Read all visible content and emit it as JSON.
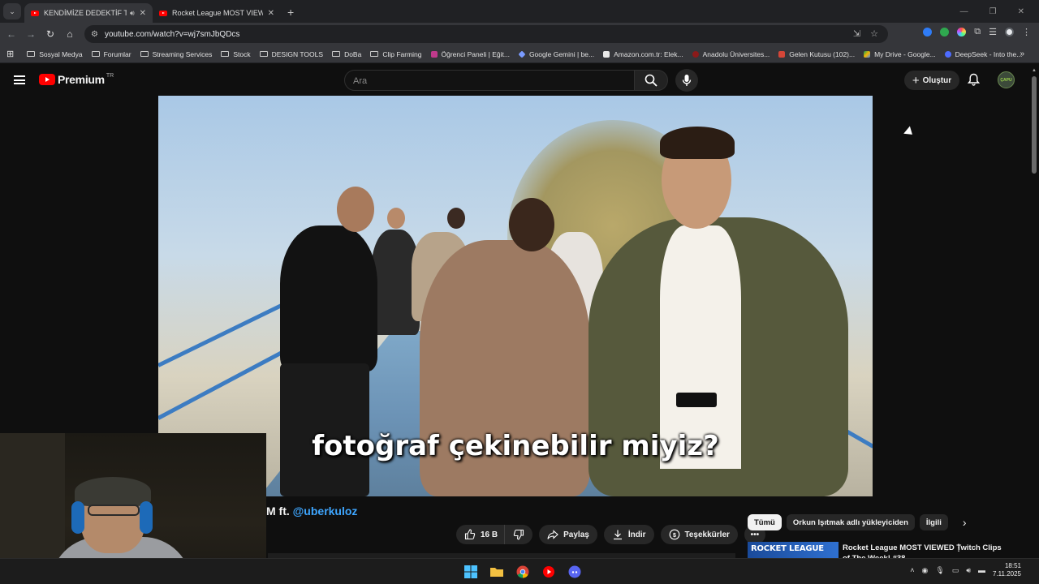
{
  "browser": {
    "tabs": [
      {
        "title": "KENDİMİZE DEDEKTİF TUTT",
        "active": true
      },
      {
        "title": "Rocket League MOST VIEWED",
        "active": false
      }
    ],
    "url": "youtube.com/watch?v=wj7smJbQDcs",
    "bookmarks": [
      {
        "label": "Sosyal Medya",
        "type": "folder"
      },
      {
        "label": "Forumlar",
        "type": "folder"
      },
      {
        "label": "Streaming Services",
        "type": "folder"
      },
      {
        "label": "Stock",
        "type": "folder"
      },
      {
        "label": "DESIGN TOOLS",
        "type": "folder"
      },
      {
        "label": "DoBa",
        "type": "folder"
      },
      {
        "label": "Clip Farming",
        "type": "folder"
      },
      {
        "label": "Öğrenci Paneli | Eğit...",
        "type": "site",
        "color": "#c03a8c"
      },
      {
        "label": "Google Gemini | be...",
        "type": "site",
        "color": "#7a9bff"
      },
      {
        "label": "Amazon.com.tr: Elek...",
        "type": "site",
        "color": "#e8e8e8"
      },
      {
        "label": "Anadolu Üniversites...",
        "type": "site",
        "color": "#8a1a1a"
      },
      {
        "label": "Gelen Kutusu (102)...",
        "type": "site",
        "color": "#d44638"
      },
      {
        "label": "My Drive - Google...",
        "type": "site",
        "color": "#f4b400"
      },
      {
        "label": "DeepSeek - Into the...",
        "type": "site",
        "color": "#4d6bfe"
      }
    ]
  },
  "youtube": {
    "logo_text": "Premium",
    "logo_country": "TR",
    "search_placeholder": "Ara",
    "create_label": "Oluştur",
    "avatar_text": "ÇAPU",
    "video": {
      "subtitle": "fotoğraf çekinebilir miyiz?",
      "title_visible": "M ft.",
      "title_mention": "@uberkuloz"
    },
    "actions": {
      "like_count": "16 B",
      "share": "Paylaş",
      "download": "İndir",
      "thanks": "Teşekkürler"
    },
    "chips": [
      "Tümü",
      "Orkun Işıtmak adlı yükleyiciden",
      "İlgili"
    ],
    "recommendation": {
      "thumb_text": "ROCKET LEAGUE",
      "title": "Rocket League MOST VIEWED Twitch Clips of The Week! #38"
    }
  },
  "taskbar": {
    "time": "18:51",
    "date": "7.11.2025"
  },
  "colors": {
    "youtube_red": "#ff0000",
    "link_blue": "#3ea6ff",
    "railing_blue": "#3c7cc2"
  }
}
